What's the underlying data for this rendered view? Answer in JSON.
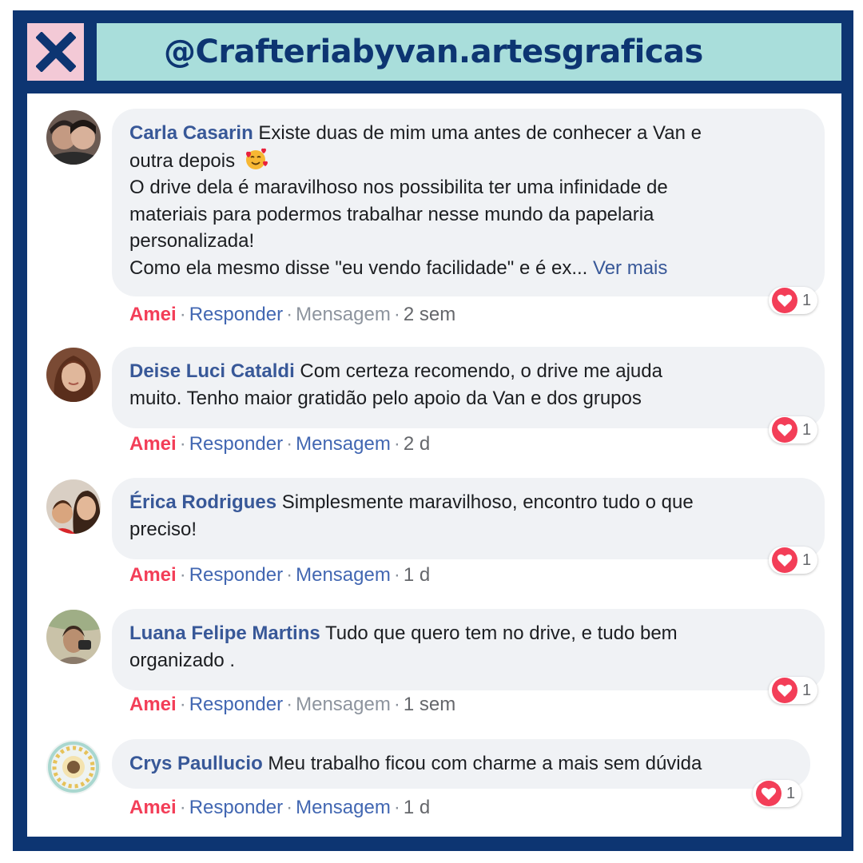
{
  "header": {
    "title": "@Crafteriabyvan.artesgraficas"
  },
  "colors": {
    "frame": "#0d3572",
    "header_bg": "#a9dedb",
    "close_bg": "#f3c9d6",
    "love": "#f33e58",
    "author": "#385898"
  },
  "comments": [
    {
      "author": "Carla Casarin",
      "line1": "Existe duas de mim uma antes de conhecer a Van e",
      "line2": "outra depois",
      "emoji": "smiling-face-with-hearts",
      "line3": "O drive dela é maravilhoso nos possibilita ter uma infinidade de",
      "line4": "materiais para podermos trabalhar nesse mundo da papelaria",
      "line5": "personalizada!",
      "line6": "Como ela mesmo disse \"eu vendo facilidade\" e é ex...",
      "see_more": "Ver mais",
      "reaction_count": "1",
      "love": "Amei",
      "reply": "Responder",
      "message": "Mensagem",
      "time": "2 sem"
    },
    {
      "author": "Deise Luci Cataldi",
      "line1": "Com certeza recomendo, o drive me ajuda",
      "line2": "muito. Tenho maior gratidão pelo apoio da Van e dos grupos",
      "reaction_count": "1",
      "love": "Amei",
      "reply": "Responder",
      "message": "Mensagem",
      "time": "2 d"
    },
    {
      "author": "Érica Rodrigues",
      "line1": "Simplesmente maravilhoso, encontro tudo o que",
      "line2": "preciso!",
      "reaction_count": "1",
      "love": "Amei",
      "reply": "Responder",
      "message": "Mensagem",
      "time": "1 d"
    },
    {
      "author": "Luana Felipe Martins",
      "line1": "Tudo que quero tem no drive, e tudo bem",
      "line2": "organizado .",
      "reaction_count": "1",
      "love": "Amei",
      "reply": "Responder",
      "message": "Mensagem",
      "time": "1 sem"
    },
    {
      "author": "Crys Paullucio",
      "line1": "Meu trabalho ficou com charme a mais sem dúvida",
      "reaction_count": "1",
      "love": "Amei",
      "reply": "Responder",
      "message": "Mensagem",
      "time": "1 d"
    }
  ]
}
